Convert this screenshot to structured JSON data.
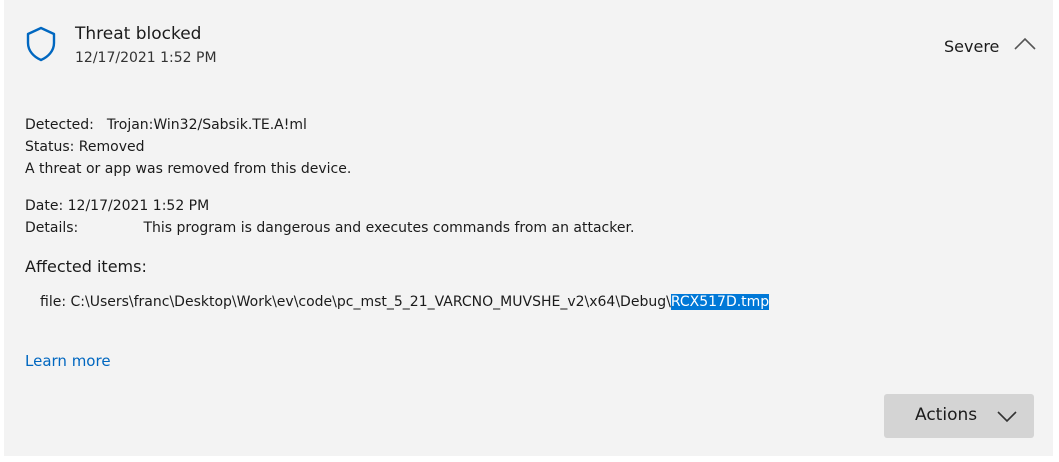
{
  "header": {
    "icon": "shield-icon",
    "title": "Threat blocked",
    "timestamp": "12/17/2021 1:52 PM",
    "severity": "Severe",
    "collapse_icon": "chevron-up-icon"
  },
  "details": {
    "detected_label": "Detected:",
    "detected_value": "Trojan:Win32/Sabsik.TE.A!ml",
    "status_label": "Status:",
    "status_value": "Removed",
    "removed_note": "A threat or app was removed from this device.",
    "date_label": "Date:",
    "date_value": "12/17/2021 1:52 PM",
    "details_label": "Details:",
    "details_value": "This program is dangerous and executes commands from an attacker."
  },
  "affected": {
    "heading": "Affected items:",
    "file_prefix": "file: C:\\Users\\franc\\Desktop\\Work\\ev\\code\\pc_mst_5_21_VARCNO_MUVSHE_v2\\x64\\Debug\\",
    "file_selected": "RCX517D.tmp"
  },
  "links": {
    "learn_more": "Learn more"
  },
  "actions": {
    "label": "Actions",
    "icon": "chevron-down-icon"
  },
  "colors": {
    "card_background": "#f3f3f3",
    "accent": "#0067c0",
    "selection": "#0078d7",
    "button_background": "#d4d4d4"
  }
}
